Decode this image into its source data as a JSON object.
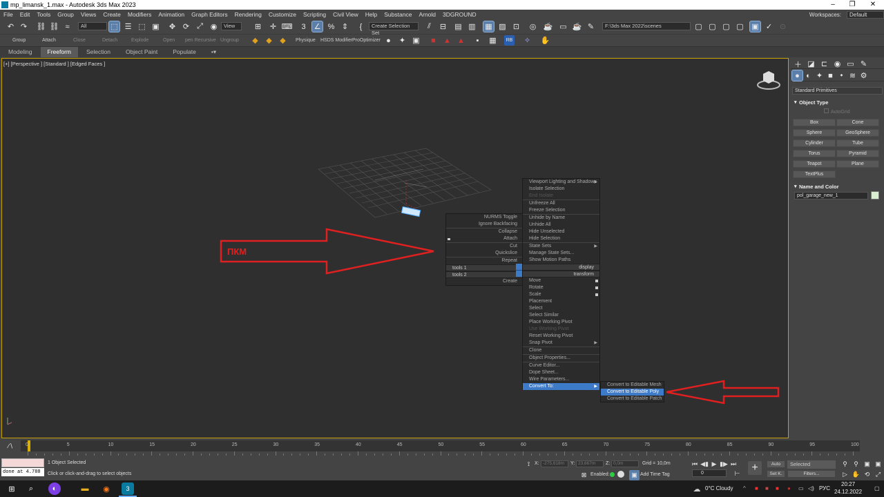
{
  "window": {
    "title": "mp_limansk_1.max - Autodesk 3ds Max 2023",
    "min": "–",
    "max": "❐",
    "close": "✕"
  },
  "menu": {
    "items": [
      "File",
      "Edit",
      "Tools",
      "Group",
      "Views",
      "Create",
      "Modifiers",
      "Animation",
      "Graph Editors",
      "Rendering",
      "Customize",
      "Scripting",
      "Civil View",
      "Help",
      "Substance",
      "Arnold",
      "3DGROUND"
    ],
    "workspaces_label": "Workspaces:",
    "workspace_value": "Default"
  },
  "toolbar": {
    "filter": "All",
    "view": "View",
    "selection_set": "Create Selection Set",
    "path": "F:\\3ds Max 2022\\scenes"
  },
  "toolbar2": {
    "labels": [
      "Group",
      "Attach",
      "Close",
      "Detach",
      "Explode",
      "Open",
      "pen Recursive",
      "Ungroup",
      "Physique",
      "HSDS Modifier",
      "ProOptimizer"
    ]
  },
  "ribbon": {
    "tabs": [
      "Modeling",
      "Freeform",
      "Selection",
      "Object Paint",
      "Populate"
    ],
    "active": "Freeform"
  },
  "viewport": {
    "label": "[+] [Perspective ] [Standard ] [Edged Faces ]"
  },
  "annotation": {
    "pkm": "ПКМ"
  },
  "quad_left": {
    "items": [
      "NURMS Toggle",
      "Ignore Backfacing",
      "Collapse",
      "Attach",
      "Cut",
      "Quickslice",
      "Repeat"
    ],
    "tools1": "tools 1",
    "tools2": "tools 2",
    "create": "Create"
  },
  "quad_right": {
    "display": [
      "Viewport Lighting and Shadows",
      "Isolate Selection",
      "End Isolate",
      "Unfreeze All",
      "Freeze Selection",
      "Unhide by Name",
      "Unhide All",
      "Hide Unselected",
      "Hide Selection",
      "State Sets",
      "Manage State Sets...",
      "Show Motion Paths"
    ],
    "display_hdr": "display",
    "transform_hdr": "transform",
    "transform": [
      "Move",
      "Rotate",
      "Scale",
      "Placement",
      "Select",
      "Select Similar",
      "Place Working Pivot",
      "Use Working Pivot",
      "Reset Working Pivot",
      "Snap Pivot",
      "Clone",
      "Object Properties...",
      "Curve Editor...",
      "Dope Sheet...",
      "Wire Parameters...",
      "Convert To:"
    ]
  },
  "convert_menu": [
    "Convert to Editable Mesh",
    "Convert to Editable Poly",
    "Convert to Editable Patch"
  ],
  "command_panel": {
    "dropdown": "Standard Primitives",
    "object_type": "Object Type",
    "autogrid": "AutoGrid",
    "buttons": [
      "Box",
      "Cone",
      "Sphere",
      "GeoSphere",
      "Cylinder",
      "Tube",
      "Torus",
      "Pyramid",
      "Teapot",
      "Plane",
      "TextPlus"
    ],
    "name_and_color": "Name and Color",
    "object_name": "pol_garage_new_1",
    "swatch": "#d8f0d0"
  },
  "timeline": {
    "frame_display": "0 / 100",
    "ticks": [
      "0",
      "5",
      "10",
      "15",
      "20",
      "25",
      "30",
      "35",
      "40",
      "45",
      "50",
      "55",
      "60",
      "65",
      "70",
      "75",
      "80",
      "85",
      "90",
      "95",
      "100"
    ]
  },
  "status": {
    "selected": "1 Object Selected",
    "hint": "Click or click-and-drag to select objects",
    "done": "done at 4.788",
    "x_label": "X:",
    "x": "-275,618m",
    "y_label": "Y:",
    "y": "23,667m",
    "z_label": "Z:",
    "z": "0,0m",
    "grid": "Grid = 10,0m",
    "enabled": "Enabled:",
    "add_time_tag": "Add Time Tag",
    "auto": "Auto",
    "setk": "Set K.",
    "selected_dd": "Selected",
    "filters": "Filters...",
    "frame": "0"
  },
  "taskbar": {
    "weather": "0°C  Cloudy",
    "lang": "РУС",
    "time": "20:27",
    "date": "24.12.2022"
  }
}
